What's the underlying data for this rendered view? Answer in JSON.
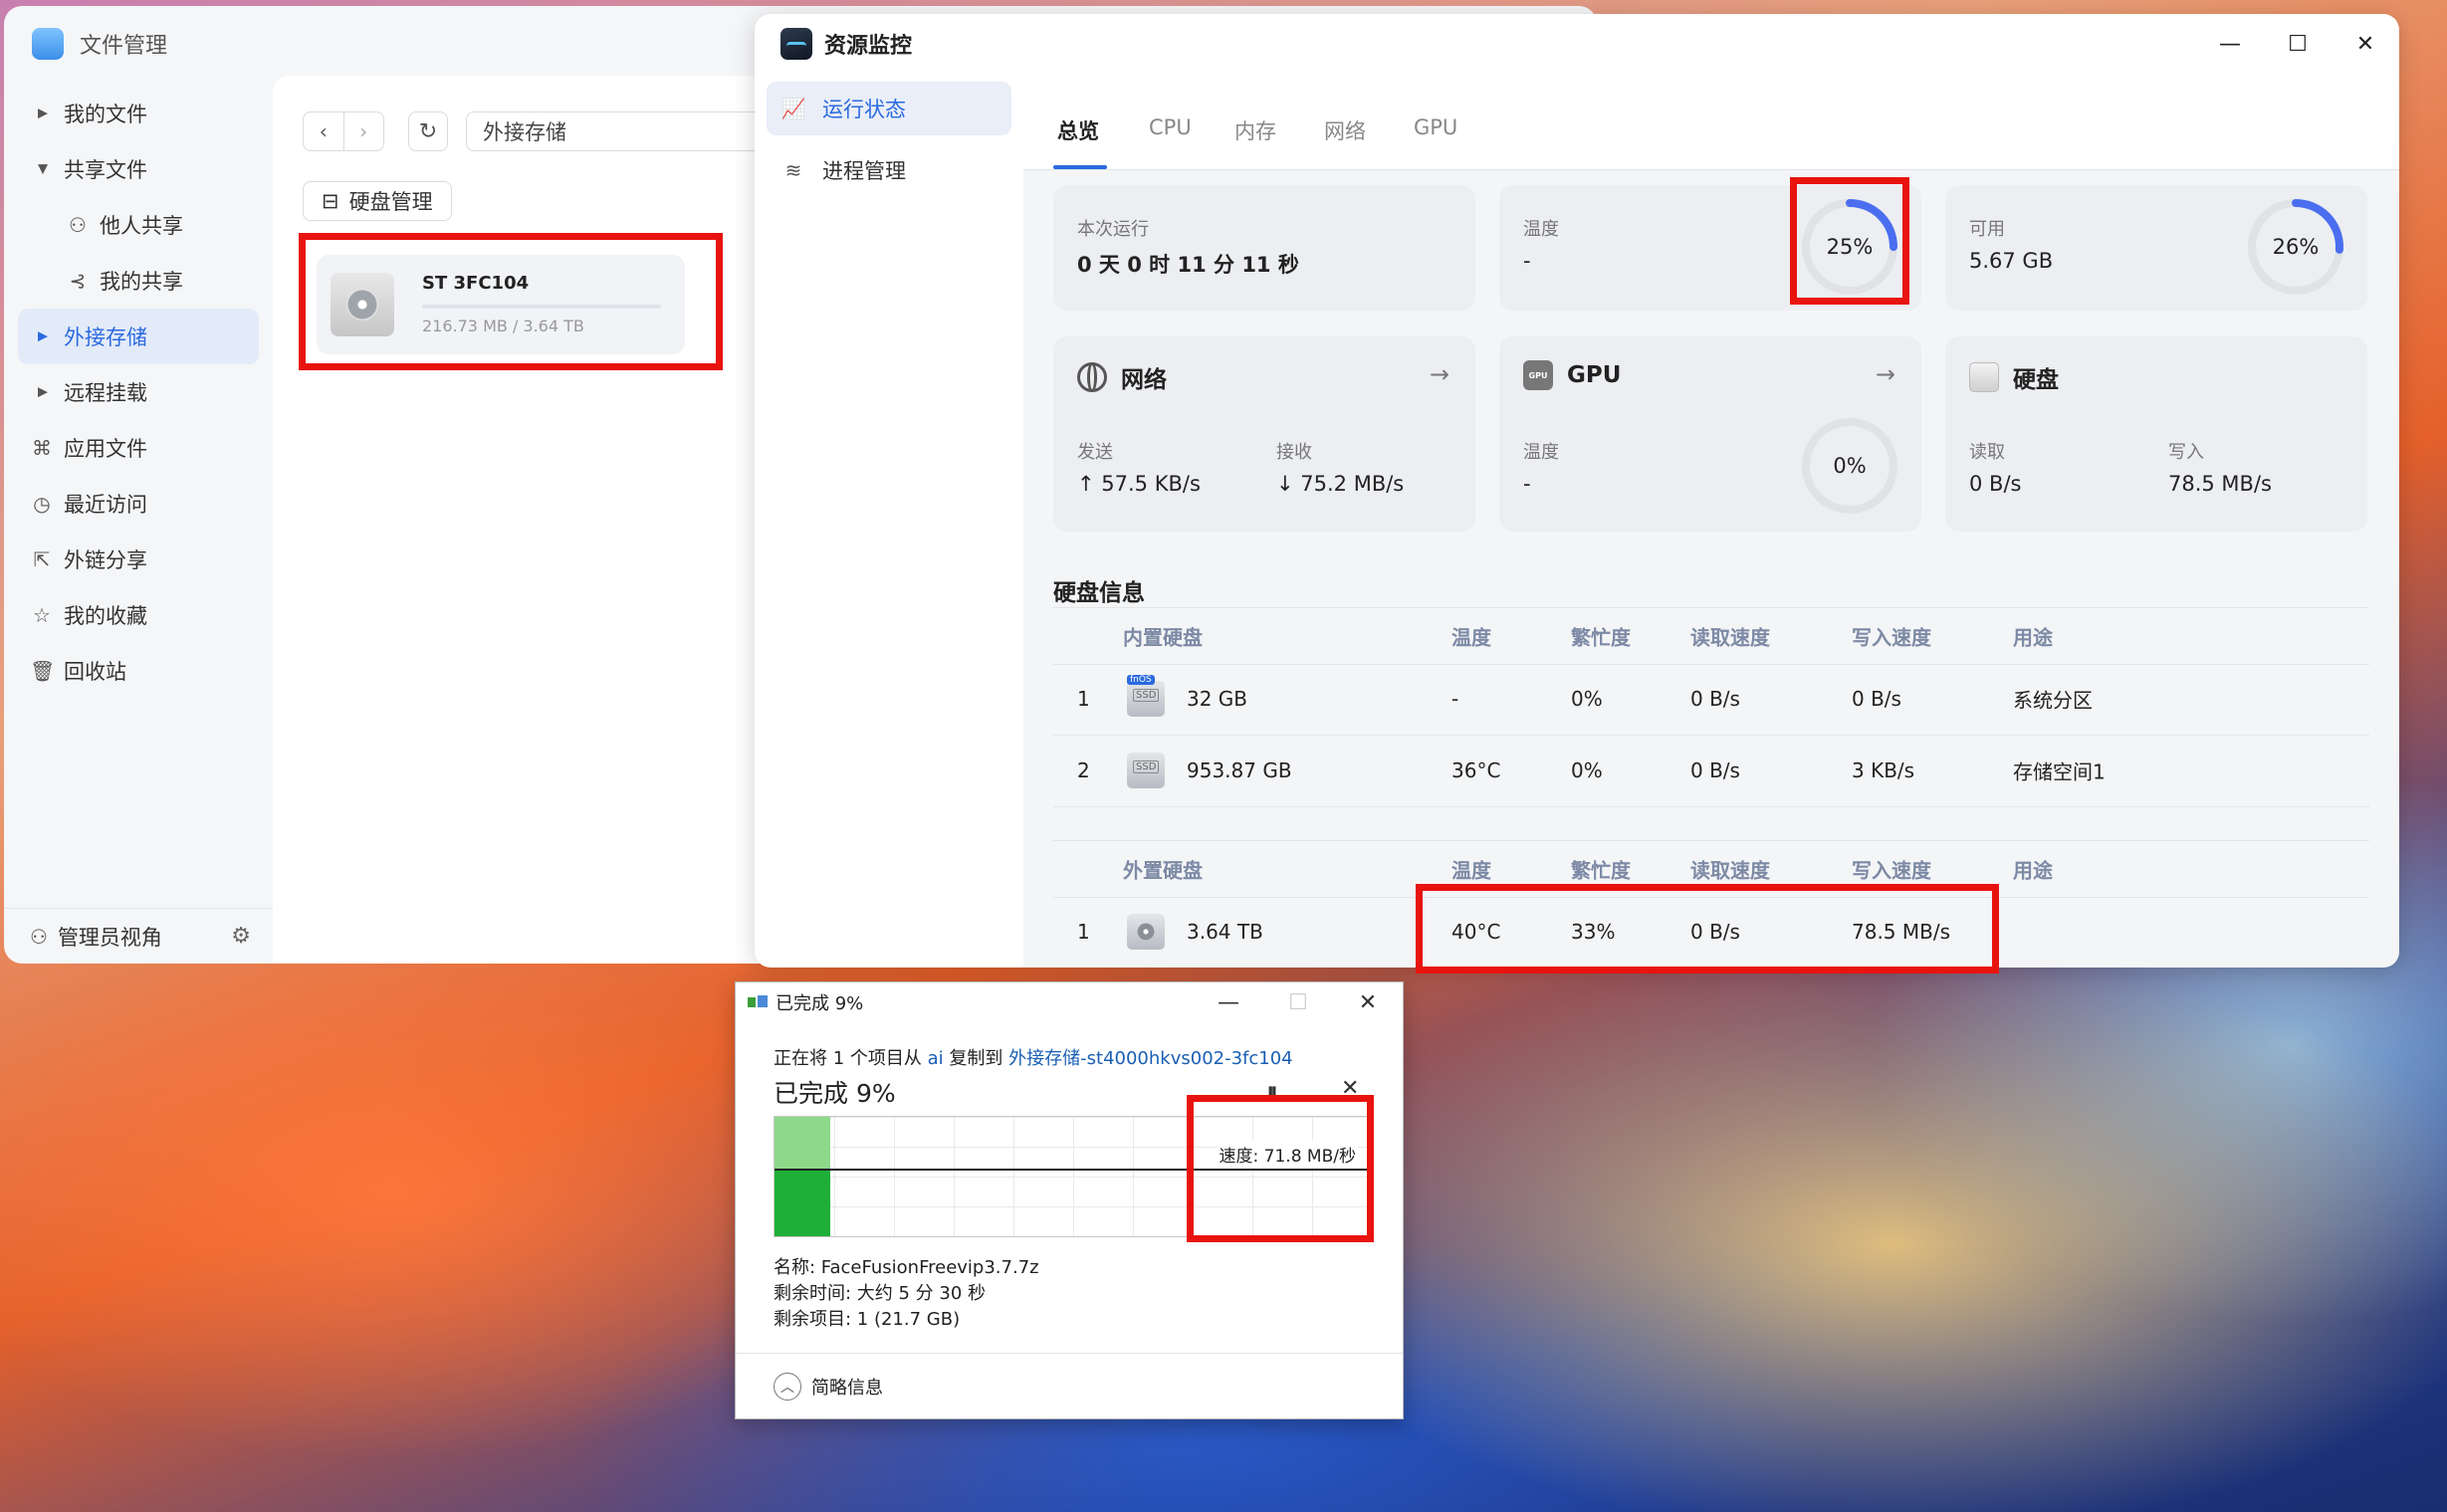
{
  "file_manager": {
    "title": "文件管理",
    "sidebar": [
      {
        "label": "我的文件",
        "icon": "caret-right-icon"
      },
      {
        "label": "共享文件",
        "icon": "caret-down-icon"
      },
      {
        "label": "他人共享",
        "icon": "user-icon"
      },
      {
        "label": "我的共享",
        "icon": "share-icon"
      },
      {
        "label": "外接存储",
        "icon": "caret-right-icon"
      },
      {
        "label": "远程挂载",
        "icon": "caret-right-icon"
      },
      {
        "label": "应用文件",
        "icon": "apps-icon"
      },
      {
        "label": "最近访问",
        "icon": "clock-icon"
      },
      {
        "label": "外链分享",
        "icon": "external-link-icon"
      },
      {
        "label": "我的收藏",
        "icon": "star-icon"
      },
      {
        "label": "回收站",
        "icon": "trash-icon"
      }
    ],
    "admin_view": "管理员视角",
    "path": "外接存储",
    "disk_manage_label": "硬盘管理",
    "disk": {
      "name": "ST                  3FC104",
      "usage": "216.73 MB / 3.64 TB"
    }
  },
  "resource_monitor": {
    "title": "资源监控",
    "nav": [
      "运行状态",
      "进程管理"
    ],
    "tabs": [
      "总览",
      "CPU",
      "内存",
      "网络",
      "GPU"
    ],
    "uptime": {
      "label": "本次运行",
      "value": "0 天 0 时 11 分 11 秒"
    },
    "cpu": {
      "temp_label": "温度",
      "temp_value": "-",
      "usage": "25%",
      "usage_fraction": 0.25
    },
    "memory": {
      "avail_label": "可用",
      "avail_value": "5.67 GB",
      "usage": "26%",
      "usage_fraction": 0.26
    },
    "network": {
      "title": "网络",
      "send_label": "发送",
      "send_value": "↑ 57.5 KB/s",
      "recv_label": "接收",
      "recv_value": "↓ 75.2 MB/s"
    },
    "gpu": {
      "title": "GPU",
      "temp_label": "温度",
      "temp_value": "-",
      "usage": "0%",
      "usage_fraction": 0.0
    },
    "disk": {
      "title": "硬盘",
      "read_label": "读取",
      "read_value": "0 B/s",
      "write_label": "写入",
      "write_value": "78.5 MB/s"
    },
    "disk_info_title": "硬盘信息",
    "internal_headers": [
      "内置硬盘",
      "温度",
      "繁忙度",
      "读取速度",
      "写入速度",
      "用途"
    ],
    "internal_rows": [
      {
        "idx": "1",
        "size": "32 GB",
        "temp": "-",
        "busy": "0%",
        "read": "0 B/s",
        "write": "0 B/s",
        "usage": "系统分区",
        "tag": "fnOS"
      },
      {
        "idx": "2",
        "size": "953.87 GB",
        "temp": "36°C",
        "busy": "0%",
        "read": "0 B/s",
        "write": "3 KB/s",
        "usage": "存储空间1",
        "tag": ""
      }
    ],
    "external_headers": [
      "外置硬盘",
      "温度",
      "繁忙度",
      "读取速度",
      "写入速度",
      "用途"
    ],
    "external_rows": [
      {
        "idx": "1",
        "size": "3.64 TB",
        "temp": "40°C",
        "busy": "33%",
        "read": "0 B/s",
        "write": "78.5 MB/s",
        "usage": ""
      }
    ]
  },
  "copy_dialog": {
    "title": "已完成 9%",
    "from_prefix": "正在将 1 个项目从",
    "from_src": "ai",
    "from_mid": "复制到",
    "from_dst": "外接存储-st4000hkvs002-3fc104",
    "progress_text": "已完成 9%",
    "progress_fraction": 0.09,
    "speed": "速度: 71.8 MB/秒",
    "name": "名称: FaceFusionFreevip3.7.7z",
    "remaining_time": "剩余时间: 大约 5 分 30 秒",
    "remaining_items": "剩余项目: 1 (21.7 GB)",
    "less_info": "简略信息"
  }
}
